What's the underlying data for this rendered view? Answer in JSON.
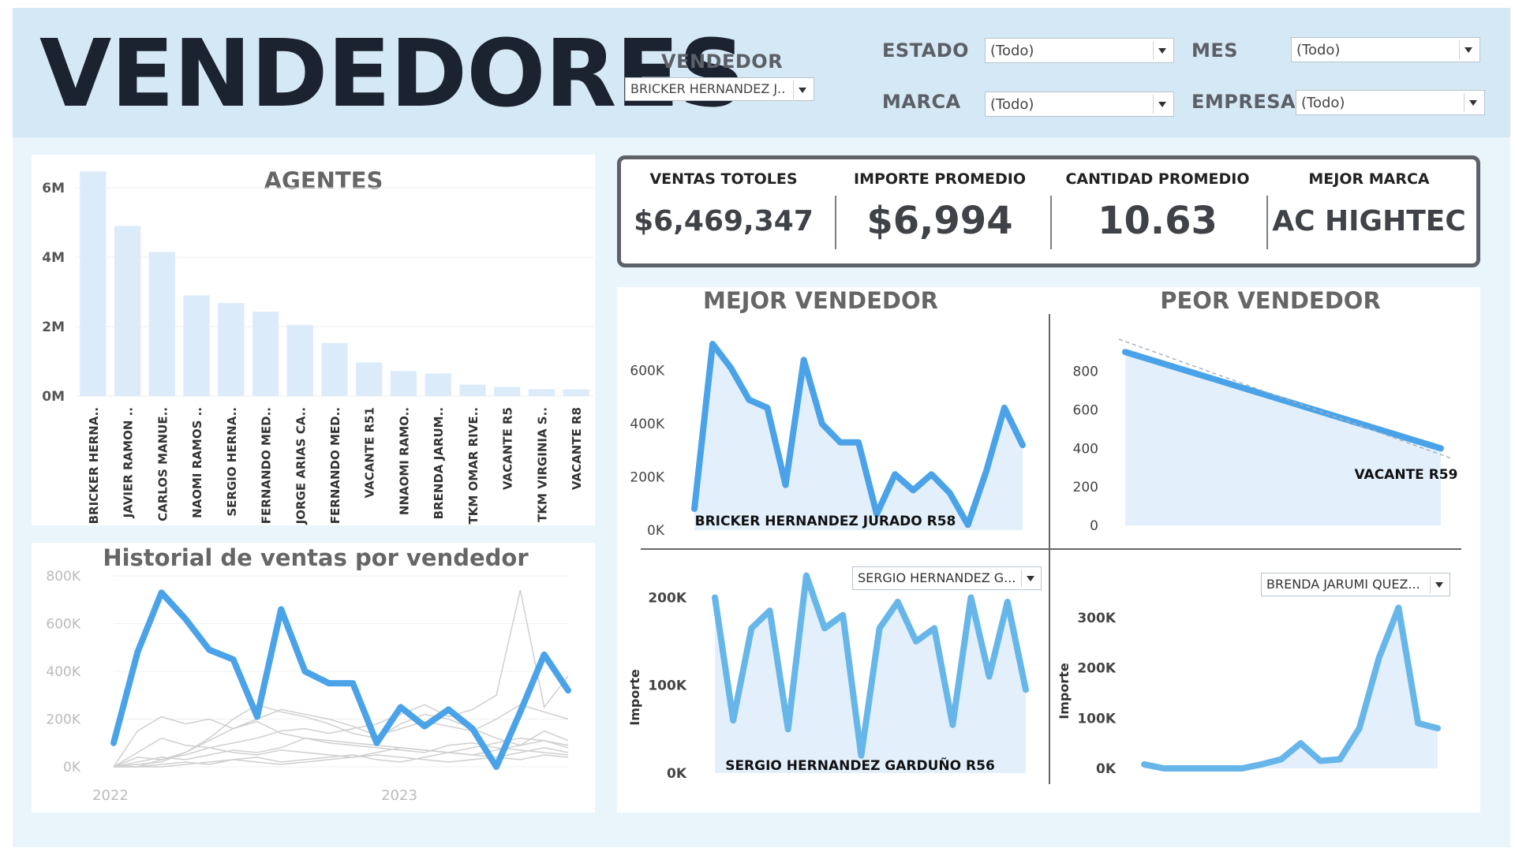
{
  "header": {
    "title": "VENDEDORES",
    "vendedor_label": "VENDEDOR",
    "vendedor_value": "BRICKER HERNANDEZ J...",
    "estado_label": "ESTADO",
    "estado_value": "(Todo)",
    "mes_label": "MES",
    "mes_value": "(Todo)",
    "marca_label": "MARCA",
    "marca_value": "(Todo)",
    "empresa_label": "EMPRESA",
    "empresa_value": "(Todo)"
  },
  "kpis": [
    {
      "label": "VENTAS TOTOLES",
      "value": "$6,469,347"
    },
    {
      "label": "IMPORTE PROMEDIO",
      "value": "$6,994"
    },
    {
      "label": "CANTIDAD PROMEDIO",
      "value": "10.63"
    },
    {
      "label": "MEJOR MARCA",
      "value": "AC HIGHTEC"
    }
  ],
  "agentes": {
    "title": "AGENTES"
  },
  "historial": {
    "title": "Historial de ventas por vendedor"
  },
  "mejor": {
    "title": "MEJOR VENDEDOR",
    "name": "BRICKER HERNANDEZ JURADO R58"
  },
  "peor": {
    "title": "PEOR VENDEDOR",
    "name": "VACANTE R59"
  },
  "seg1": {
    "dropdown": "SERGIO HERNANDEZ G...",
    "name": "SERGIO HERNANDEZ GARDUÑO R56",
    "ylabel": "Importe"
  },
  "seg2": {
    "dropdown": "BRENDA JARUMI QUEZ...",
    "ylabel": "Importe"
  },
  "colors": {
    "accent": "#4aa3e8",
    "bar": "#dcebfa",
    "area": "#e3f0fc",
    "header_bg": "#d5e8f5",
    "dashboard_bg": "#eaf4fb"
  },
  "chart_data": [
    {
      "type": "bar",
      "title": "AGENTES",
      "categories": [
        "BRICKER HERNA..",
        "JAVIER RAMON ..",
        "CARLOS MANUE..",
        "NAOMI RAMOS ..",
        "SERGIO HERNA..",
        "FERNANDO MED..",
        "JORGE ARIAS CA..",
        "FERNANDO MED..",
        "VACANTE R51",
        "NNAOMI RAMO..",
        "BRENDA JARUM..",
        "TKM OMAR RIVE..",
        "VACANTE R5",
        "TKM VIRGINIA S..",
        "VACANTE R8"
      ],
      "values": [
        6469347,
        4900000,
        4150000,
        2900000,
        2680000,
        2430000,
        2050000,
        1530000,
        970000,
        720000,
        650000,
        330000,
        260000,
        200000,
        190000
      ],
      "yticks": [
        "6M",
        "4M",
        "2M",
        "0M"
      ],
      "ylim": [
        0,
        6500000
      ]
    },
    {
      "type": "line",
      "title": "Historial de ventas por vendedor",
      "xticks": [
        "2022",
        "2023"
      ],
      "yticks": [
        "800K",
        "600K",
        "400K",
        "200K",
        "0K"
      ],
      "ylim": [
        0,
        800000
      ],
      "series": [
        {
          "values": [
            100000,
            480000,
            730000,
            620000,
            490000,
            450000,
            210000,
            660000,
            400000,
            350000,
            350000,
            100000,
            250000,
            170000,
            240000,
            160000,
            0,
            230000,
            470000,
            320000
          ]
        }
      ]
    },
    {
      "type": "area",
      "title": "MEJOR VENDEDOR",
      "yticks": [
        "600K",
        "400K",
        "200K",
        "0K"
      ],
      "ylim": [
        0,
        700000
      ],
      "values": [
        80000,
        700000,
        610000,
        490000,
        460000,
        170000,
        640000,
        400000,
        330000,
        330000,
        60000,
        210000,
        150000,
        210000,
        140000,
        20000,
        220000,
        460000,
        320000
      ]
    },
    {
      "type": "area",
      "title": "PEOR VENDEDOR",
      "yticks": [
        "800",
        "600",
        "400",
        "200",
        "0"
      ],
      "ylim": [
        0,
        950
      ],
      "values": [
        900,
        400
      ]
    },
    {
      "type": "area",
      "ylabel": "Importe",
      "yticks": [
        "200K",
        "100K",
        "0K"
      ],
      "ylim": [
        0,
        230000
      ],
      "values": [
        200000,
        60000,
        165000,
        185000,
        50000,
        225000,
        165000,
        180000,
        20000,
        165000,
        195000,
        150000,
        165000,
        55000,
        200000,
        110000,
        195000,
        95000
      ]
    },
    {
      "type": "area",
      "ylabel": "Importe",
      "yticks": [
        "300K",
        "200K",
        "100K",
        "0K"
      ],
      "ylim": [
        0,
        330000
      ],
      "values": [
        8000,
        0,
        0,
        0,
        0,
        0,
        8000,
        18000,
        50000,
        15000,
        18000,
        80000,
        220000,
        320000,
        90000,
        80000
      ]
    }
  ]
}
